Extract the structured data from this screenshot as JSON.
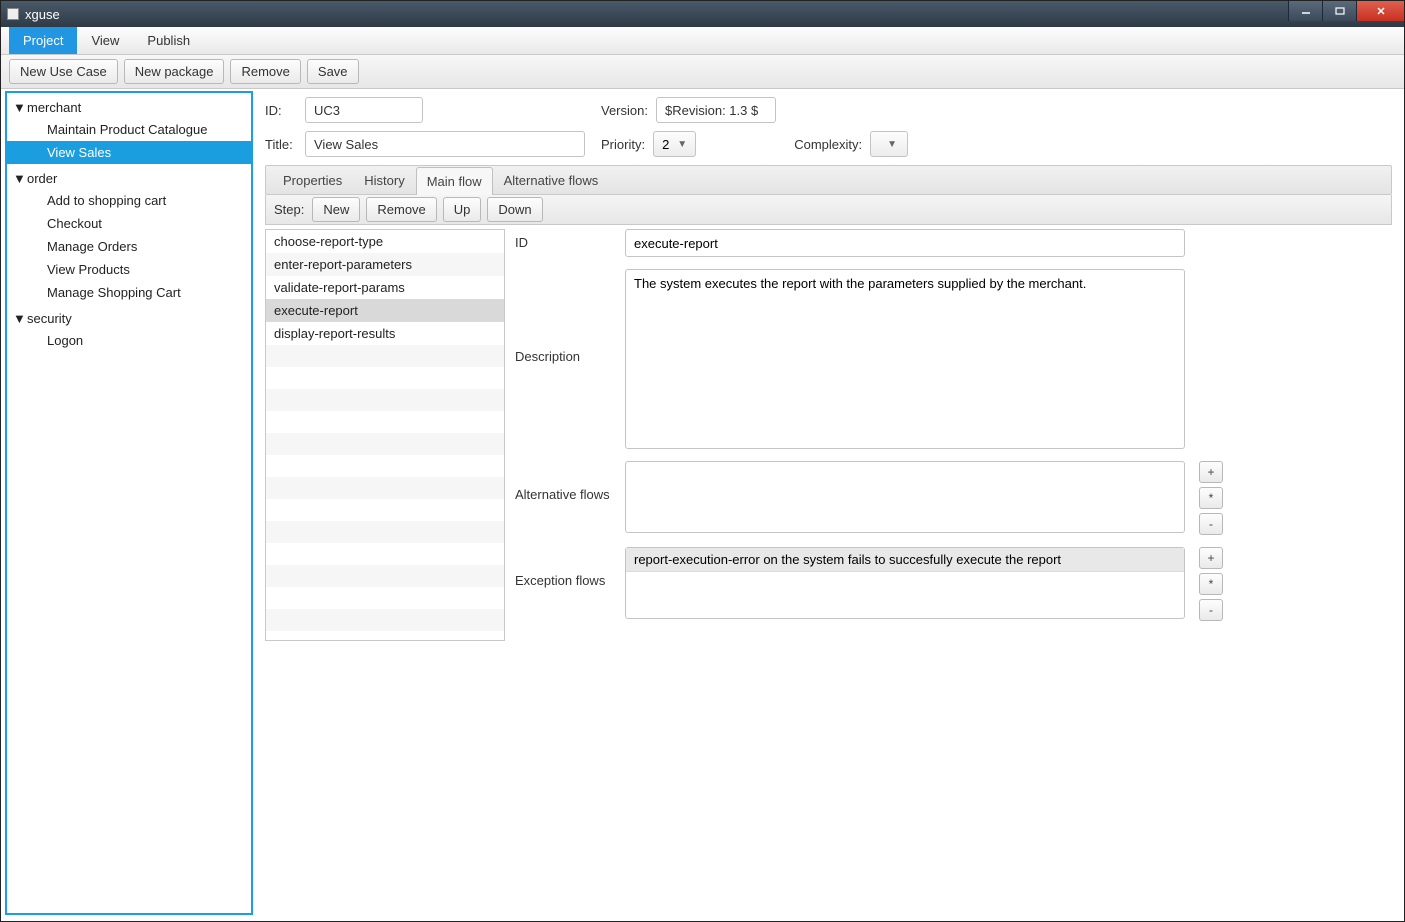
{
  "window": {
    "title": "xguse"
  },
  "menubar": {
    "project": "Project",
    "view": "View",
    "publish": "Publish",
    "active": "project"
  },
  "toolbar": {
    "new_use_case": "New Use Case",
    "new_package": "New package",
    "remove": "Remove",
    "save": "Save"
  },
  "tree": {
    "groups": [
      {
        "name": "merchant",
        "items": [
          "Maintain Product Catalogue",
          "View Sales"
        ],
        "selected": "View Sales"
      },
      {
        "name": "order",
        "items": [
          "Add to shopping cart",
          "Checkout",
          "Manage Orders",
          "View Products",
          "Manage Shopping Cart"
        ]
      },
      {
        "name": "security",
        "items": [
          "Logon"
        ]
      }
    ]
  },
  "form": {
    "id_label": "ID:",
    "id_value": "UC3",
    "title_label": "Title:",
    "title_value": "View Sales",
    "version_label": "Version:",
    "version_value": "$Revision: 1.3 $",
    "priority_label": "Priority:",
    "priority_value": "2",
    "complexity_label": "Complexity:",
    "complexity_value": ""
  },
  "tabs": {
    "properties": "Properties",
    "history": "History",
    "main_flow": "Main flow",
    "alternative_flows": "Alternative flows",
    "active": "main_flow"
  },
  "steps": {
    "label": "Step:",
    "btn_new": "New",
    "btn_remove": "Remove",
    "btn_up": "Up",
    "btn_down": "Down",
    "items": [
      "choose-report-type",
      "enter-report-parameters",
      "validate-report-params",
      "execute-report",
      "display-report-results"
    ],
    "selected": "execute-report"
  },
  "detail": {
    "id_label": "ID",
    "id_value": "execute-report",
    "desc_label": "Description",
    "desc_value": "The system executes the report with the parameters supplied by the merchant.",
    "alt_label": "Alternative flows",
    "exc_label": "Exception flows",
    "exc_items": [
      "report-execution-error on the system fails to succesfully execute the report"
    ],
    "btn_add": "+",
    "btn_star": "*",
    "btn_minus": "-"
  }
}
